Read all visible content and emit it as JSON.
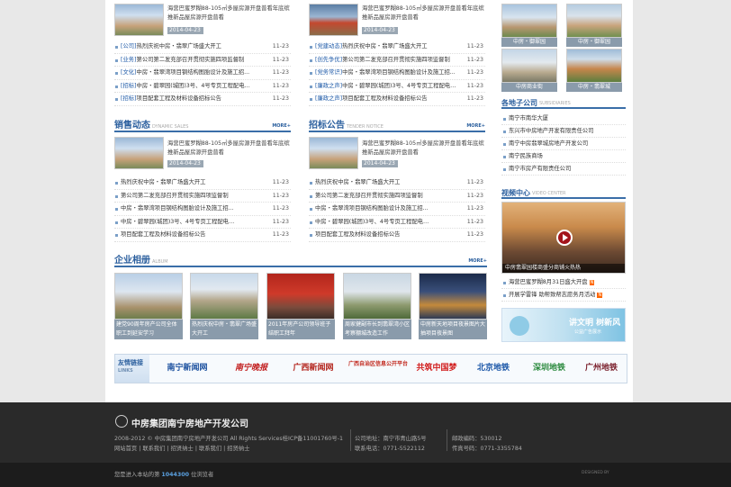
{
  "top_left": {
    "summary": "海营巴蜜罗糊88-105㎡多屋房源开盘普看年底缤推新品屋房源开盘普看",
    "date": "2014-04-23",
    "rows": [
      {
        "cat": "[公司]",
        "text": "热烈庆祝中房・翡翠广场盛大开工",
        "date": "11-23"
      },
      {
        "cat": "[业务]",
        "text": "第公司第二发充部召开贯彻实施四项监督制",
        "date": "11-23"
      },
      {
        "cat": "[文化]",
        "text": "中房・翡翠湾项目钢结构图胎设计及施工招...",
        "date": "11-23"
      },
      {
        "cat": "[招标]",
        "text": "中房・碧翠园(城团)3号、4号专页工程配电…",
        "date": "11-23"
      },
      {
        "cat": "[招标]",
        "text": "项目配套工程及材料设备招标公告",
        "date": "11-23"
      }
    ]
  },
  "top_right": {
    "summary": "海营巴蜜罗糊88-105㎡多屋房源开盘普看年底缤推新品屋房源开盘普看",
    "date": "2014-04-23",
    "rows": [
      {
        "cat": "[党建动态]",
        "text": "热烈庆祝中房・翡翠广场盛大开工",
        "date": "11-23"
      },
      {
        "cat": "[创先争优]",
        "text": "第公司第二发充部召开贯彻实施四项监督制",
        "date": "11-23"
      },
      {
        "cat": "[党务常识]",
        "text": "中房・翡翠湾项目钢结构图胎设计及施工招...",
        "date": "11-23"
      },
      {
        "cat": "[廉政之声]",
        "text": "中房・碧翠园(城团)3号、4号专页工程配电…",
        "date": "11-23"
      },
      {
        "cat": "[廉政之声]",
        "text": "项目配套工程及材料设备招标公告",
        "date": "11-23"
      }
    ]
  },
  "sales": {
    "title": "销售动态",
    "sub": "DYNAMIC SALES",
    "more": "MORE+",
    "summary": "海营巴蜜罗糊88-105㎡多屋房源开盘普看年底缤推新品屋房源开盘普看",
    "date": "2014-04-23",
    "rows": [
      {
        "text": "热烈庆祝中房・翡翠广场盛大开工",
        "date": "11-23"
      },
      {
        "text": "第公司第二发充部召开贯彻实施四项监督制",
        "date": "11-23"
      },
      {
        "text": "中房・翡翠湾项目钢结构图胎设计及施工招...",
        "date": "11-23"
      },
      {
        "text": "中房・碧翠园(城团)3号、4号专页工程配电…",
        "date": "11-23"
      },
      {
        "text": "项目配套工程及材料设备招标公告",
        "date": "11-23"
      }
    ]
  },
  "tender": {
    "title": "招标公告",
    "sub": "TENDER NOTICE",
    "more": "MORE+",
    "summary": "海营巴蜜罗糊88-105㎡多屋房源开盘普看年底缤推新品屋房源开盘普看",
    "date": "2014-04-23",
    "rows": [
      {
        "text": "热烈庆祝中房・翡翠广场盛大开工",
        "date": "11-23"
      },
      {
        "text": "第公司第二发充部召开贯彻实施四项监督制",
        "date": "11-23"
      },
      {
        "text": "中房・翡翠湾项目钢结构图胎设计及施工招...",
        "date": "11-23"
      },
      {
        "text": "中房・碧翠园(城团)3号、4号专页工程配电…",
        "date": "11-23"
      },
      {
        "text": "项目配套工程及材料设备招标公告",
        "date": "11-23"
      }
    ]
  },
  "album": {
    "title": "企业相册",
    "sub": "ALBUM",
    "more": "MORE+",
    "items": [
      "建党90周年房产公司全体职工到延安学习",
      "热烈庆祝中房・翡翠广场盛大开工",
      "2011年房产公司领导班子结职工拜年",
      "周家健副市长到翡翠湾小区考察棚城改造工作",
      "中房新天地项目夜景图片大抽项目夜景图"
    ]
  },
  "links": {
    "label_cn": "友情链接",
    "label_en": "LINKS",
    "logos": [
      "南宁新闻网",
      "南宁晚报",
      "广西新闻网",
      "广西自治区信息公开平台",
      "共筑中国梦",
      "北京地铁",
      "深圳地铁",
      "广州地铁"
    ]
  },
  "properties": [
    "中房・御翠园",
    "中房・御翠园",
    "中房商业街",
    "中房・翡翠城"
  ],
  "subsidiaries": {
    "title": "各地子公司",
    "sub": "SUBSIDIARIES",
    "items": [
      "南宁市南华大厦",
      "东兴市中房地产开发有限责任公司",
      "南宁中房翡翠城房地产开发公司",
      "南宁民族商场",
      "南宁市房产有限责任公司"
    ]
  },
  "video": {
    "title": "视频中心",
    "sub": "VIDEO CENTER",
    "caption": "中房翡翠园楼商盛分商铺火热热",
    "items": [
      "海营巴蜜罗糊8月31日盛大开盘",
      "开展学雷锋 助帮致帮志愿务月活动"
    ],
    "banner_big": "讲文明 树新风",
    "banner_small": "公益广告展示"
  },
  "footer": {
    "company": "中房集团南宁房地产开发公司",
    "copyright": "2008-2012 © 中房集团南宁房地产开发公司 All Rights Services桂ICP备11001760号-1",
    "nav": [
      "网站首页",
      "联系我们",
      "招贤纳士",
      "联系我们",
      "招贤纳士"
    ],
    "address": "公司地址：南宁市青山路5号",
    "phone": "联系电话：0771-5522112",
    "zip": "邮政编码：530012",
    "fax": "传真号码：0771-3355784",
    "visitor_prefix": "您是进入本站的第",
    "visitor_count": "1044300",
    "visitor_suffix": "位浏览者",
    "credit": "DESIGNED BY"
  },
  "colors": {
    "accent": "#2b5f9e",
    "footer": "#2a2a2a",
    "badge": "#ff6600"
  }
}
